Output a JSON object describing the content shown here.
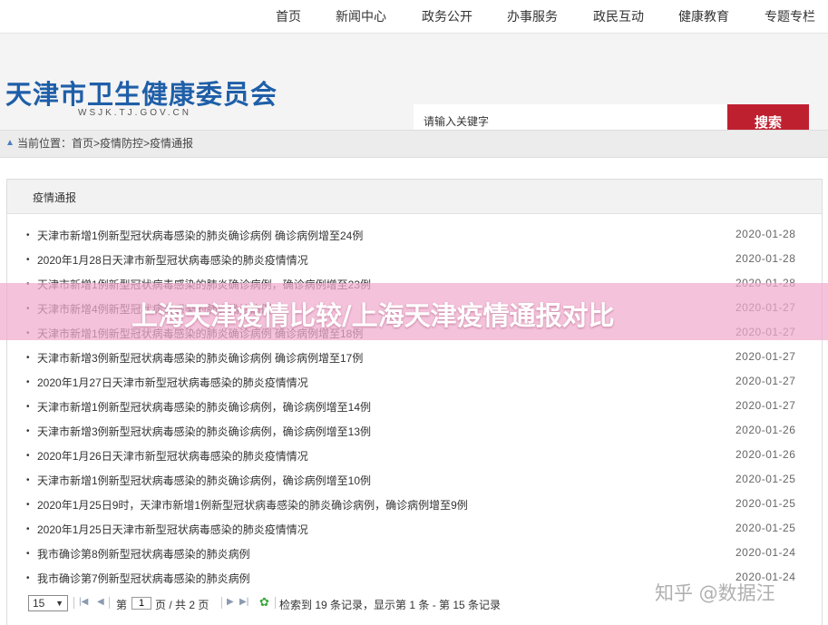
{
  "nav": {
    "items": [
      "首页",
      "新闻中心",
      "政务公开",
      "办事服务",
      "政民互动",
      "健康教育",
      "专题专栏"
    ]
  },
  "header": {
    "site_title": "天津市卫生健康委员会",
    "site_url": "WSJK.TJ.GOV.CN",
    "search_placeholder": "请输入关键字",
    "search_button": "搜索"
  },
  "breadcrumb": {
    "text": "当前位置：首页>疫情防控>疫情通报"
  },
  "panel": {
    "title": "疫情通报",
    "items": [
      {
        "title": "天津市新增1例新型冠状病毒感染的肺炎确诊病例 确诊病例增至24例",
        "date": "2020-01-28"
      },
      {
        "title": "2020年1月28日天津市新型冠状病毒感染的肺炎疫情情况",
        "date": "2020-01-28"
      },
      {
        "title": "天津市新增1例新型冠状病毒感染的肺炎确诊病例，确诊病例增至23例",
        "date": "2020-01-28"
      },
      {
        "title": "天津市新增4例新型冠状病毒感染的肺炎确诊病例",
        "date": "2020-01-27"
      },
      {
        "title": "天津市新增1例新型冠状病毒感染的肺炎确诊病例 确诊病例增至18例",
        "date": "2020-01-27"
      },
      {
        "title": "天津市新增3例新型冠状病毒感染的肺炎确诊病例 确诊病例增至17例",
        "date": "2020-01-27"
      },
      {
        "title": "2020年1月27日天津市新型冠状病毒感染的肺炎疫情情况",
        "date": "2020-01-27"
      },
      {
        "title": "天津市新增1例新型冠状病毒感染的肺炎确诊病例，确诊病例增至14例",
        "date": "2020-01-27"
      },
      {
        "title": "天津市新增3例新型冠状病毒感染的肺炎确诊病例，确诊病例增至13例",
        "date": "2020-01-26"
      },
      {
        "title": "2020年1月26日天津市新型冠状病毒感染的肺炎疫情情况",
        "date": "2020-01-26"
      },
      {
        "title": "天津市新增1例新型冠状病毒感染的肺炎确诊病例，确诊病例增至10例",
        "date": "2020-01-25"
      },
      {
        "title": "2020年1月25日9时，天津市新增1例新型冠状病毒感染的肺炎确诊病例，确诊病例增至9例",
        "date": "2020-01-25"
      },
      {
        "title": "2020年1月25日天津市新型冠状病毒感染的肺炎疫情情况",
        "date": "2020-01-25"
      },
      {
        "title": "我市确诊第8例新型冠状病毒感染的肺炎病例",
        "date": "2020-01-24"
      },
      {
        "title": "我市确诊第7例新型冠状病毒感染的肺炎病例",
        "date": "2020-01-24"
      }
    ]
  },
  "pager": {
    "page_size": "15",
    "page_label_pre": "第",
    "current_page": "1",
    "page_label_post": "页 / 共 2 页",
    "summary": "检索到 19 条记录，显示第 1 条 - 第 15 条记录"
  },
  "overlay": {
    "banner": "上海天津疫情比较/上海天津疫情通报对比",
    "watermark": "知乎 @数据汪"
  },
  "colors": {
    "brand_blue": "#1f5fa8",
    "search_red": "#bf2030",
    "banner_pink": "#f0aacd"
  },
  "icons": [
    "home-icon",
    "first-page-icon",
    "prev-page-icon",
    "next-page-icon",
    "last-page-icon",
    "refresh-icon"
  ]
}
